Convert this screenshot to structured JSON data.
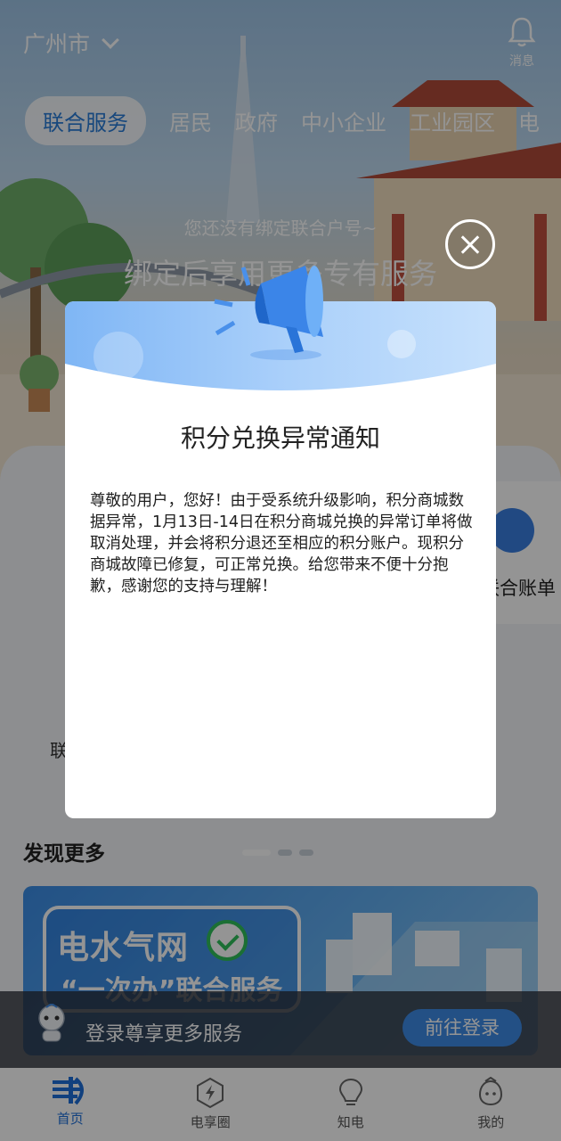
{
  "header": {
    "city": "广州市",
    "message_label": "消息"
  },
  "tabs": [
    {
      "label": "联合服务",
      "active": true
    },
    {
      "label": "居民"
    },
    {
      "label": "政府"
    },
    {
      "label": "中小企业"
    },
    {
      "label": "工业园区"
    },
    {
      "label": "电"
    }
  ],
  "hero": {
    "hint": "您还没有绑定联合户号~",
    "tagline": "绑定后享用更多专有服务"
  },
  "main": {
    "bill_label": "联合账单",
    "partial_label": "联",
    "discover_title": "发现更多",
    "carousel_dots": 3,
    "active_dot": 0
  },
  "banner": {
    "line1": "电水气网",
    "line2": "“一次办”联合服务"
  },
  "login_bar": {
    "text": "登录尊享更多服务",
    "button": "前往登录"
  },
  "tabbar": [
    {
      "label": "首页",
      "icon": "home-icon",
      "active": true
    },
    {
      "label": "电享圈",
      "icon": "lightning-hexagon-icon"
    },
    {
      "label": "知电",
      "icon": "lightbulb-icon"
    },
    {
      "label": "我的",
      "icon": "profile-mascot-icon"
    }
  ],
  "modal": {
    "title": "积分兑换异常通知",
    "body": "尊敬的用户，您好！由于受系统升级影响，积分商城数据异常，1月13日-14日在积分商城兑换的异常订单将做取消处理，并会将积分退还至相应的积分账户。现积分商城故障已修复，可正常兑换。给您带来不便十分抱歉，感谢您的支持与理解！"
  },
  "colors": {
    "accent": "#2a7cd8",
    "tab_active": "#1e6fd9",
    "overlay": "rgba(0,0,0,0.42)"
  }
}
